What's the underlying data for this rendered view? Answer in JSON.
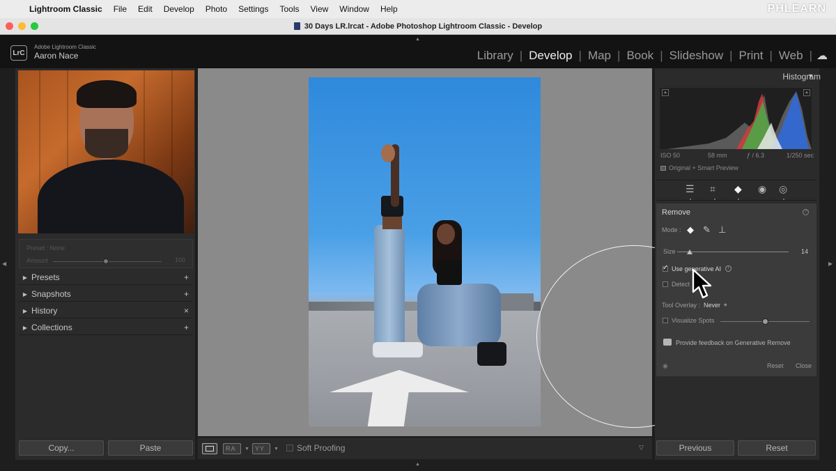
{
  "menubar": {
    "app": "Lightroom Classic",
    "items": [
      "File",
      "Edit",
      "Develop",
      "Photo",
      "Settings",
      "Tools",
      "View",
      "Window",
      "Help"
    ],
    "watermark": "PHLEARN"
  },
  "window": {
    "title": "30 Days LR.lrcat - Adobe Photoshop Lightroom Classic - Develop"
  },
  "identity": {
    "badge": "LrC",
    "product": "Adobe Lightroom Classic",
    "user": "Aaron Nace"
  },
  "modules": {
    "items": [
      "Library",
      "Develop",
      "Map",
      "Book",
      "Slideshow",
      "Print",
      "Web"
    ],
    "active": "Develop"
  },
  "left_panel": {
    "preset_label": "Preset : None",
    "amount_label": "Amount",
    "amount_value": "100",
    "sections": [
      {
        "label": "Presets",
        "action": "+"
      },
      {
        "label": "Snapshots",
        "action": "+"
      },
      {
        "label": "History",
        "action": "×"
      },
      {
        "label": "Collections",
        "action": "+"
      }
    ],
    "copy_button": "Copy...",
    "paste_button": "Paste"
  },
  "toolbar": {
    "view1_label": "RA",
    "view2_label": "YY",
    "soft_proofing": "Soft Proofing"
  },
  "histogram": {
    "title": "Histogram",
    "iso": "ISO 50",
    "focal": "58 mm",
    "aperture": "ƒ / 6.3",
    "shutter": "1/250 sec",
    "preview": "Original + Smart Preview"
  },
  "remove_panel": {
    "title": "Remove",
    "mode_label": "Mode :",
    "size_label": "Size",
    "size_value": "14",
    "size_fraction": 0.11,
    "use_generative_ai": "Use generative AI",
    "use_generative_ai_checked": true,
    "detect_label": "Detect",
    "tool_overlay_label": "Tool Overlay :",
    "tool_overlay_value": "Never",
    "visualize_spots": "Visualize Spots",
    "feedback": "Provide feedback on Generative Remove",
    "reset": "Reset",
    "close": "Close"
  },
  "right_buttons": {
    "previous": "Previous",
    "reset": "Reset"
  },
  "colors": {
    "panel_bg": "#2b2b2b",
    "tool_panel_bg": "#3b3b3b",
    "sky": "#2f89dc"
  }
}
